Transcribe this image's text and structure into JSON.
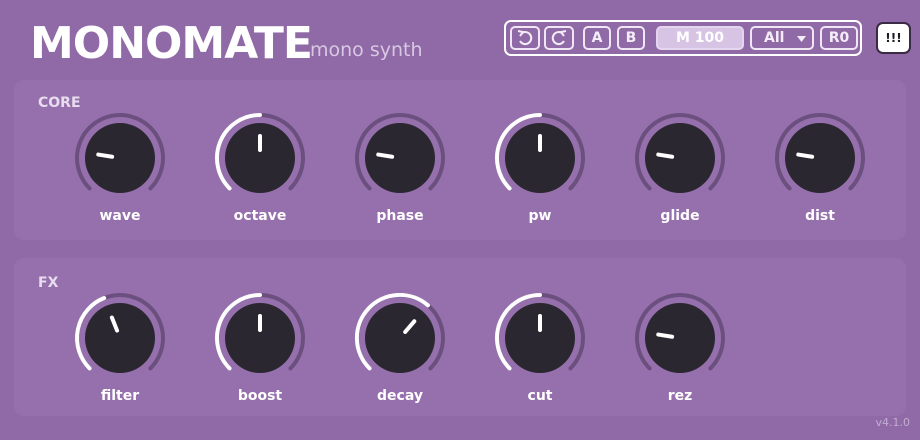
{
  "header": {
    "title": "MONOMATE",
    "subtitle": "mono synth"
  },
  "toolbar": {
    "undo_icon": "undo-icon",
    "redo_icon": "redo-icon",
    "a_label": "A",
    "b_label": "B",
    "preset_label": "M 100",
    "filter_label": "All",
    "r_label": "R0",
    "alert_label": "!!!"
  },
  "sections": {
    "core": {
      "label": "CORE",
      "knobs": [
        {
          "label": "wave",
          "value": 0.2
        },
        {
          "label": "octave",
          "value": 0.5
        },
        {
          "label": "phase",
          "value": 0.2
        },
        {
          "label": "pw",
          "value": 0.5
        },
        {
          "label": "glide",
          "value": 0.2
        },
        {
          "label": "dist",
          "value": 0.2
        }
      ]
    },
    "fx": {
      "label": "FX",
      "knobs": [
        {
          "label": "filter",
          "value": 0.42
        },
        {
          "label": "boost",
          "value": 0.5
        },
        {
          "label": "decay",
          "value": 0.65
        },
        {
          "label": "cut",
          "value": 0.5
        },
        {
          "label": "rez",
          "value": 0.2
        }
      ]
    }
  },
  "footer": {
    "version": "v4.1.0"
  },
  "colors": {
    "background": "#8f6aa6",
    "panel": "#9670ad",
    "knob_body": "#2a2730",
    "track": "#6b4f7e",
    "arc": "#ffffff"
  }
}
